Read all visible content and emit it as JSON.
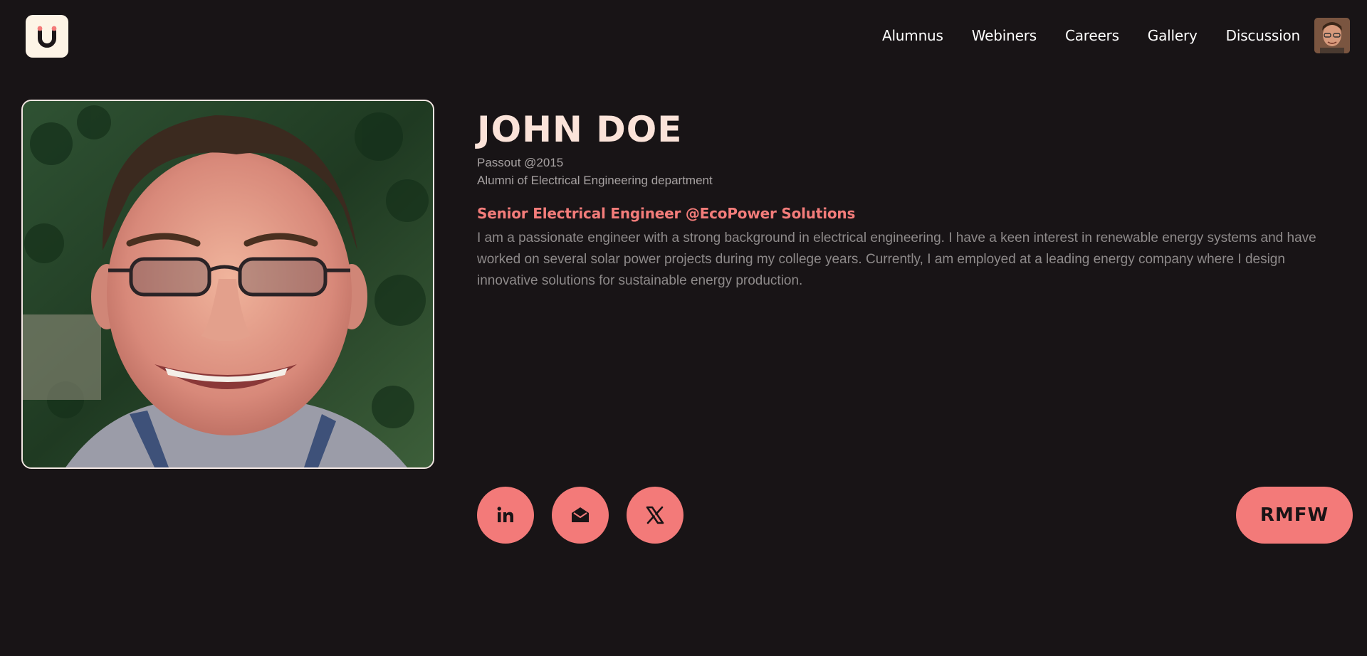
{
  "header": {
    "logo_icon": "u-logo-icon",
    "nav": [
      {
        "label": "Alumnus"
      },
      {
        "label": "Webiners"
      },
      {
        "label": "Careers"
      },
      {
        "label": "Gallery"
      },
      {
        "label": "Discussion"
      }
    ],
    "avatar_icon": "user-avatar"
  },
  "profile": {
    "name": "JOHN DOE",
    "passout": "Passout @2015",
    "department": "Alumni of Electrical Engineering department",
    "role": "Senior Electrical Engineer @EcoPower Solutions",
    "bio": "I am a passionate engineer with a strong background in electrical engineering. I have a keen interest in renewable energy systems and have worked on several solar power projects during my college years. Currently, I am employed at a leading energy company where I design innovative solutions for sustainable energy production."
  },
  "socials": [
    {
      "icon": "linkedin-icon"
    },
    {
      "icon": "mail-icon"
    },
    {
      "icon": "x-icon"
    }
  ],
  "action_button": {
    "label": "RMFW"
  },
  "colors": {
    "background": "#181416",
    "accent": "#f37a79",
    "name": "#fbe3d9",
    "role": "#f37c7a"
  }
}
